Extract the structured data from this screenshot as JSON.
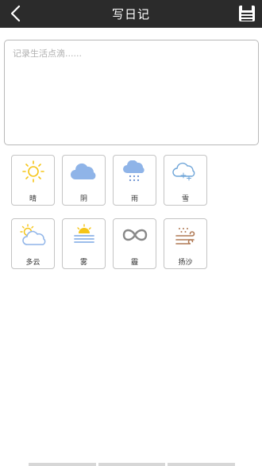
{
  "header": {
    "title": "写日记",
    "back_icon": "chevron-left-icon",
    "save_icon": "floppy-disk-icon"
  },
  "diary": {
    "placeholder": "记录生活点滴......",
    "value": ""
  },
  "weather": [
    {
      "key": "sunny",
      "label": "晴",
      "icon": "sun-icon",
      "color": "#f5c518"
    },
    {
      "key": "overcast",
      "label": "阴",
      "icon": "cloud-icon",
      "color": "#8fb4e8"
    },
    {
      "key": "rain",
      "label": "雨",
      "icon": "rain-cloud-icon",
      "color": "#8fb4e8"
    },
    {
      "key": "snow",
      "label": "雪",
      "icon": "snow-cloud-icon",
      "color": "#6fa5d8"
    },
    {
      "key": "cloudy",
      "label": "多云",
      "icon": "sun-cloud-icon",
      "color": "#f5c518"
    },
    {
      "key": "fog",
      "label": "雾",
      "icon": "fog-icon",
      "color": "#8fb4e8"
    },
    {
      "key": "haze",
      "label": "霾",
      "icon": "haze-icon",
      "color": "#888888"
    },
    {
      "key": "sandstorm",
      "label": "扬沙",
      "icon": "sandstorm-icon",
      "color": "#b07a55"
    }
  ]
}
